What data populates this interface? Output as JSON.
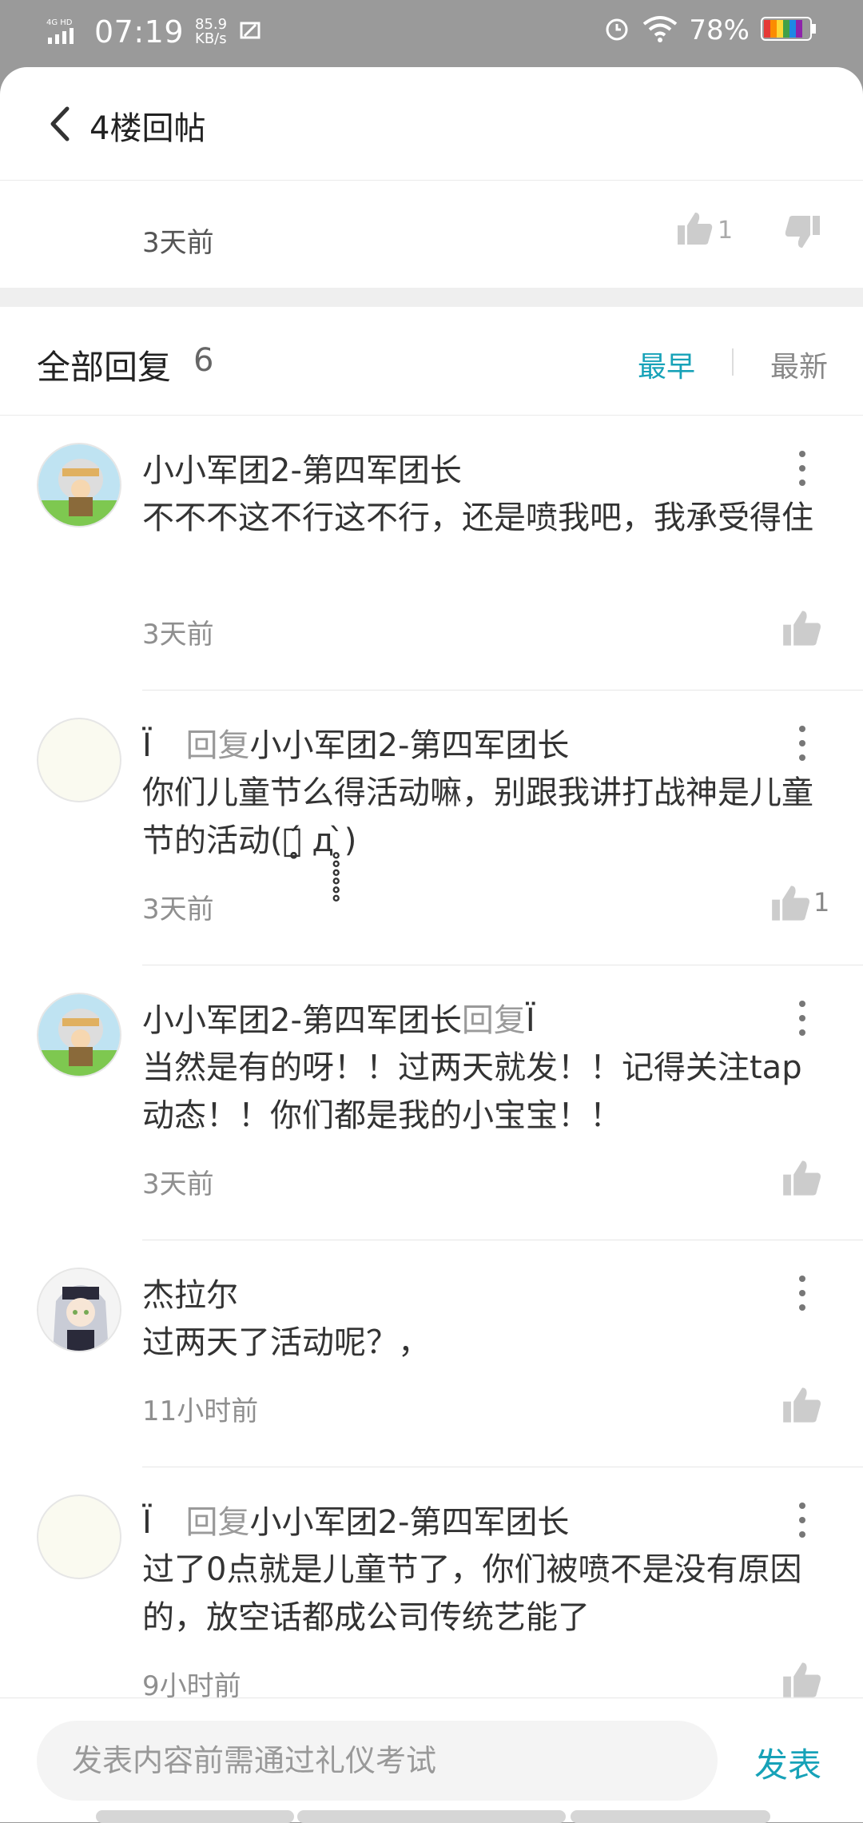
{
  "status_bar": {
    "network": "4G HD",
    "time": "07:19",
    "speed_value": "85.9",
    "speed_unit": "KB/s",
    "battery": "78%"
  },
  "header": {
    "title": "4楼回帖"
  },
  "post_meta": {
    "time": "3天前",
    "like_count": "1"
  },
  "replies_header": {
    "label": "全部回复",
    "count": "6",
    "sort_earliest": "最早",
    "sort_latest": "最新"
  },
  "replies": [
    {
      "name": "小小军团2-第四军团长",
      "reply_word": "",
      "reply_to": "",
      "text": "不不不这不行这不行，还是喷我吧，我承受得住",
      "time": "3天前",
      "likes": ""
    },
    {
      "name": "Ï",
      "reply_word": "回复",
      "reply_to": "小小军团2-第四军团长",
      "text": "你们儿童节么得活动嘛，别跟我讲打战神是儿童节的活动(ﾟ̥̥̥̥̥̥́ д ̥̥̥̥̥̥̀)",
      "time": "3天前",
      "likes": "1"
    },
    {
      "name": "小小军团2-第四军团长",
      "reply_word": "回复",
      "reply_to": "Ï",
      "text": "当然是有的呀！！过两天就发！！记得关注tap动态！！你们都是我的小宝宝！！",
      "time": "3天前",
      "likes": ""
    },
    {
      "name": "杰拉尔",
      "reply_word": "",
      "reply_to": "",
      "text": "过两天了活动呢？，",
      "time": "11小时前",
      "likes": ""
    },
    {
      "name": "Ï",
      "reply_word": "回复",
      "reply_to": "小小军团2-第四军团长",
      "text": "过了0点就是儿童节了，你们被喷不是没有原因的，放空话都成公司传统艺能了",
      "time": "9小时前",
      "likes": ""
    }
  ],
  "composer": {
    "placeholder": "发表内容前需通过礼仪考试",
    "submit": "发表"
  },
  "colors": {
    "accent": "#17a2b8",
    "status_bg": "#9a9a9a"
  }
}
